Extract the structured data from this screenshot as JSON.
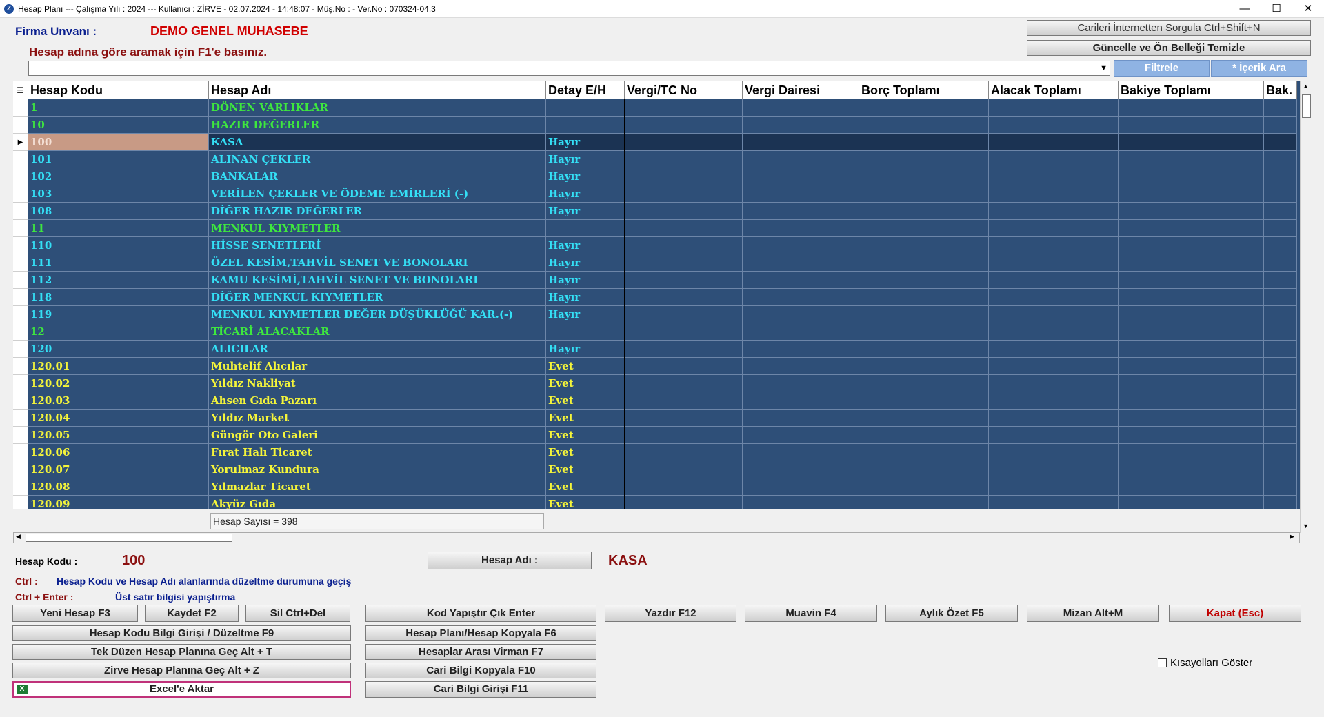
{
  "window": {
    "title": "Hesap Planı  ---  Çalışma Yılı : 2024  ---  Kullanıcı : ZİRVE - 02.07.2024 - 14:48:07 - Müş.No :  - Ver.No : 070324-04.3",
    "minimize": "—",
    "maximize": "☐",
    "close": "✕"
  },
  "header": {
    "firma_label": "Firma Unvanı :",
    "firma_value": "DEMO GENEL MUHASEBE",
    "search_hint": "Hesap adına göre aramak için F1'e basınız.",
    "search_value": "",
    "btn_internet": "Carileri İnternetten Sorgula Ctrl+Shift+N",
    "btn_guncelle": "Güncelle ve Ön Belleği Temizle",
    "btn_filtrele": "Filtrele",
    "btn_icerik": "* İçerik Ara"
  },
  "grid": {
    "columns": [
      "Hesap Kodu",
      "Hesap Adı",
      "Detay E/H",
      "Vergi/TC No",
      "Vergi Dairesi",
      "Borç Toplamı",
      "Alacak Toplamı",
      "Bakiye Toplamı",
      "Bak."
    ],
    "rows": [
      {
        "code": "1",
        "name": "DÖNEN VARLIKLAR",
        "detay": "",
        "color": "green"
      },
      {
        "code": "10",
        "name": "HAZIR DEĞERLER",
        "detay": "",
        "color": "green"
      },
      {
        "code": "100",
        "name": "KASA",
        "detay": "Hayır",
        "color": "cyan",
        "selected": true
      },
      {
        "code": "101",
        "name": "ALINAN ÇEKLER",
        "detay": "Hayır",
        "color": "cyan"
      },
      {
        "code": "102",
        "name": "BANKALAR",
        "detay": "Hayır",
        "color": "cyan"
      },
      {
        "code": "103",
        "name": "VERİLEN ÇEKLER VE ÖDEME EMİRLERİ (-)",
        "detay": "Hayır",
        "color": "cyan"
      },
      {
        "code": "108",
        "name": "DİĞER HAZIR DEĞERLER",
        "detay": "Hayır",
        "color": "cyan"
      },
      {
        "code": "11",
        "name": "MENKUL KIYMETLER",
        "detay": "",
        "color": "green"
      },
      {
        "code": "110",
        "name": "HİSSE SENETLERİ",
        "detay": "Hayır",
        "color": "cyan"
      },
      {
        "code": "111",
        "name": "ÖZEL KESİM,TAHVİL SENET VE BONOLARI",
        "detay": "Hayır",
        "color": "cyan"
      },
      {
        "code": "112",
        "name": "KAMU KESİMİ,TAHVİL SENET VE BONOLARI",
        "detay": "Hayır",
        "color": "cyan"
      },
      {
        "code": "118",
        "name": "DİĞER MENKUL KIYMETLER",
        "detay": "Hayır",
        "color": "cyan"
      },
      {
        "code": "119",
        "name": "MENKUL KIYMETLER DEĞER DÜŞÜKLÜĞÜ KAR.(-)",
        "detay": "Hayır",
        "color": "cyan"
      },
      {
        "code": "12",
        "name": "TİCARİ ALACAKLAR",
        "detay": "",
        "color": "green"
      },
      {
        "code": "120",
        "name": "ALICILAR",
        "detay": "Hayır",
        "color": "cyan"
      },
      {
        "code": "120.01",
        "name": "Muhtelif Alıcılar",
        "detay": "Evet",
        "color": "yellow"
      },
      {
        "code": "120.02",
        "name": "Yıldız Nakliyat",
        "detay": "Evet",
        "color": "yellow"
      },
      {
        "code": "120.03",
        "name": "Ahsen Gıda Pazarı",
        "detay": "Evet",
        "color": "yellow"
      },
      {
        "code": "120.04",
        "name": "Yıldız Market",
        "detay": "Evet",
        "color": "yellow"
      },
      {
        "code": "120.05",
        "name": "Güngör Oto Galeri",
        "detay": "Evet",
        "color": "yellow"
      },
      {
        "code": "120.06",
        "name": "Fırat Halı Ticaret",
        "detay": "Evet",
        "color": "yellow"
      },
      {
        "code": "120.07",
        "name": "Yorulmaz Kundura",
        "detay": "Evet",
        "color": "yellow"
      },
      {
        "code": "120.08",
        "name": "Yılmazlar Ticaret",
        "detay": "Evet",
        "color": "yellow"
      },
      {
        "code": "120.09",
        "name": "Akyüz Gıda",
        "detay": "Evet",
        "color": "yellow"
      }
    ],
    "count_text": "Hesap Sayısı = 398"
  },
  "info": {
    "hesap_kodu_label": "Hesap Kodu :",
    "hesap_kodu_value": "100",
    "hesap_adi_label": "Hesap Adı :",
    "hesap_adi_value": "KASA",
    "ctrl_label": "Ctrl :",
    "ctrl_desc": "Hesap Kodu ve Hesap Adı alanlarında düzeltme durumuna geçiş",
    "ctrl_enter_label": "Ctrl + Enter :",
    "ctrl_enter_desc": "Üst satır bilgisi yapıştırma"
  },
  "buttons": {
    "yeni": "Yeni Hesap F3",
    "kaydet": "Kaydet F2",
    "sil": "Sil Ctrl+Del",
    "kod_yapistir": "Kod Yapıştır Çık Enter",
    "yazdir": "Yazdır F12",
    "muavin": "Muavin F4",
    "aylik": "Aylık Özet F5",
    "mizan": "Mizan Alt+M",
    "kapat": "Kapat (Esc)",
    "bilgi_girisi": "Hesap Kodu Bilgi Girişi / Düzeltme F9",
    "kopyala": "Hesap Planı/Hesap Kopyala F6",
    "tek_duzen": "Tek Düzen Hesap Planına Geç Alt + T",
    "virman": "Hesaplar Arası Virman F7",
    "zirve": "Zirve Hesap Planına Geç Alt + Z",
    "cari_kopyala": "Cari Bilgi Kopyala F10",
    "excel": "Excel'e Aktar",
    "cari_giris": "Cari Bilgi Girişi F11",
    "kisayollar": "Kısayolları Göster"
  }
}
